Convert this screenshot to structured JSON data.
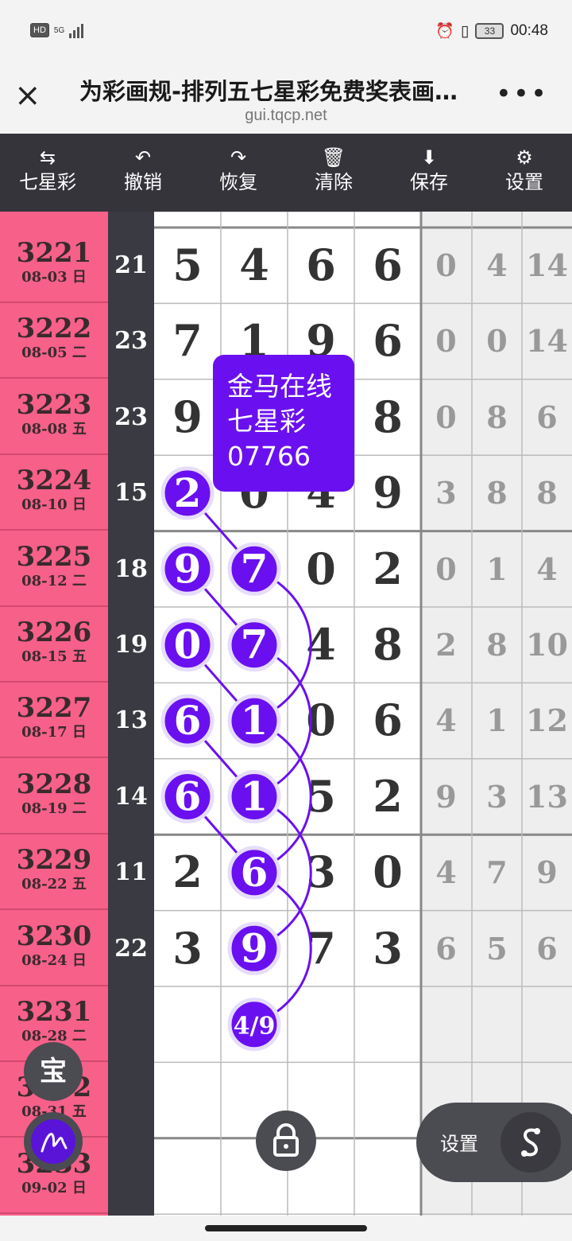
{
  "status": {
    "hd": "HD",
    "net": "5G",
    "time": "00:48",
    "battery": "33"
  },
  "header": {
    "close": "×",
    "title": "为彩画规-排列五七星彩免费奖表画…",
    "url": "gui.tqcp.net",
    "more": "•••"
  },
  "toolbar": [
    {
      "icon": "⇆",
      "label": "七星彩"
    },
    {
      "icon": "↶",
      "label": "撤销"
    },
    {
      "icon": "↷",
      "label": "恢复"
    },
    {
      "icon": "🗑",
      "label": "清除"
    },
    {
      "icon": "⬇",
      "label": "保存"
    },
    {
      "icon": "⚙",
      "label": "设置"
    }
  ],
  "rows": [
    {
      "issue": "3221",
      "date": "08-03 日",
      "sum": "21",
      "nums": [
        "5",
        "4",
        "6",
        "6"
      ],
      "side": [
        "0",
        "4",
        "14"
      ]
    },
    {
      "issue": "3222",
      "date": "08-05 二",
      "sum": "23",
      "nums": [
        "7",
        "1",
        "9",
        "6"
      ],
      "side": [
        "0",
        "0",
        "14"
      ]
    },
    {
      "issue": "3223",
      "date": "08-08 五",
      "sum": "23",
      "nums": [
        "9",
        "",
        "",
        "8"
      ],
      "side": [
        "0",
        "8",
        "6"
      ]
    },
    {
      "issue": "3224",
      "date": "08-10 日",
      "sum": "15",
      "nums": [
        "",
        "0",
        "4",
        "9"
      ],
      "side": [
        "3",
        "8",
        "8"
      ]
    },
    {
      "issue": "3225",
      "date": "08-12 二",
      "sum": "18",
      "nums": [
        "",
        "",
        "0",
        "2"
      ],
      "side": [
        "0",
        "1",
        "4"
      ]
    },
    {
      "issue": "3226",
      "date": "08-15 五",
      "sum": "19",
      "nums": [
        "",
        "",
        "4",
        "8"
      ],
      "side": [
        "2",
        "8",
        "10"
      ]
    },
    {
      "issue": "3227",
      "date": "08-17 日",
      "sum": "13",
      "nums": [
        "",
        "",
        "0",
        "6"
      ],
      "side": [
        "4",
        "1",
        "12"
      ]
    },
    {
      "issue": "3228",
      "date": "08-19 二",
      "sum": "14",
      "nums": [
        "",
        "",
        "5",
        "2"
      ],
      "side": [
        "9",
        "3",
        "13"
      ]
    },
    {
      "issue": "3229",
      "date": "08-22 五",
      "sum": "11",
      "nums": [
        "2",
        "",
        "3",
        "0"
      ],
      "side": [
        "4",
        "7",
        "9"
      ]
    },
    {
      "issue": "3230",
      "date": "08-24 日",
      "sum": "22",
      "nums": [
        "3",
        "",
        "7",
        "3"
      ],
      "side": [
        "6",
        "5",
        "6"
      ]
    },
    {
      "issue": "3231",
      "date": "08-28 二",
      "sum": "",
      "nums": [
        "",
        "",
        "",
        ""
      ],
      "side": [
        "",
        "",
        ""
      ]
    },
    {
      "issue": "3232",
      "date": "08-31 五",
      "sum": "",
      "nums": [
        "",
        "",
        "",
        ""
      ],
      "side": [
        "",
        "",
        ""
      ]
    },
    {
      "issue": "3233",
      "date": "09-02 日",
      "sum": "",
      "nums": [
        "",
        "",
        "",
        ""
      ],
      "side": [
        "",
        "",
        ""
      ]
    }
  ],
  "circles": [
    {
      "text": "2",
      "col": 0,
      "row": 3
    },
    {
      "text": "9",
      "col": 0,
      "row": 4
    },
    {
      "text": "0",
      "col": 0,
      "row": 5
    },
    {
      "text": "6",
      "col": 0,
      "row": 6
    },
    {
      "text": "6",
      "col": 0,
      "row": 7
    },
    {
      "text": "7",
      "col": 1,
      "row": 4
    },
    {
      "text": "7",
      "col": 1,
      "row": 5
    },
    {
      "text": "1",
      "col": 1,
      "row": 6
    },
    {
      "text": "1",
      "col": 1,
      "row": 7
    },
    {
      "text": "6",
      "col": 1,
      "row": 8
    },
    {
      "text": "9",
      "col": 1,
      "row": 9
    },
    {
      "text": "4/9",
      "col": 1,
      "row": 10
    }
  ],
  "popup": {
    "line1": "金马在线",
    "line2": "七星彩",
    "line3": "07766"
  },
  "fabs": {
    "bao": "宝",
    "settings": "设置"
  },
  "colors": {
    "accent": "#6a10f0",
    "issue_bg": "#f76089",
    "toolbar_bg": "#35343b"
  }
}
